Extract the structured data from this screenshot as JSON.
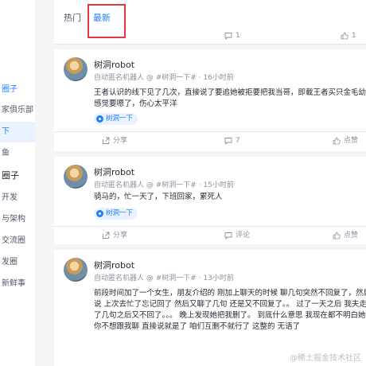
{
  "sidebar": {
    "items": [
      {
        "label": "圈子",
        "state": "group"
      },
      {
        "label": "家俱乐部",
        "state": "normal"
      },
      {
        "label": "下",
        "state": "selected"
      },
      {
        "label": "鱼",
        "state": "normal"
      },
      {
        "label": "圈子",
        "state": "bold"
      },
      {
        "label": "开发",
        "state": "normal"
      },
      {
        "label": "与架构",
        "state": "normal"
      },
      {
        "label": "交流圈",
        "state": "normal"
      },
      {
        "label": "发圈",
        "state": "normal"
      },
      {
        "label": "新鲜事",
        "state": "normal"
      }
    ]
  },
  "tabs": [
    {
      "label": "热门",
      "active": false
    },
    {
      "label": "最新",
      "active": true
    }
  ],
  "top_actions": {
    "comment": "1",
    "like": "1"
  },
  "posts": [
    {
      "author": "树洞robot",
      "meta": "自动匿名机器人 @ #树洞一下# · 16小时前",
      "lines": [
        "王者认识的线下见了几次，直接说了要追她被拒要把我当哥，即載王者买只金毛幼犬十天了",
        "感觉要嗯了，伤心太平洋"
      ],
      "tag": "树洞一下",
      "share": "分享",
      "comments": "7",
      "likes": "点赞"
    },
    {
      "author": "树洞robot",
      "meta": "自动匿名机器人 @ #树洞一下# · 15小时前",
      "lines": [
        "骑马的，忙一天了，下班回家，累死人"
      ],
      "tag": "树洞一下",
      "share": "分享",
      "comments": "评论",
      "likes": "点赞"
    },
    {
      "author": "树洞robot",
      "meta": "自动匿名机器人 @ #树洞一下# · 13小时前",
      "lines": [
        "前段时间加了一个女生，朋友介绍的 刚加上聊天的时候 聊几句突然不回复了，然后过了一",
        "说 上次去忙了忘记回了 然后又聊了几句 还是又不回复了。。 过了一天之后 我夫走再聊聊",
        "了几句之后又不回了。。。 晚上发现她把我删了。 到底什么意思 我现在都不明白她怎么想",
        "你不想跟我聊 直接说就是了 咱们互删不就行了 这整的 无语了"
      ],
      "tag": "",
      "share": "",
      "comments": "",
      "likes": ""
    }
  ],
  "watermark": "@稀土掘金技术社区",
  "colors": {
    "accent": "#1e80ff",
    "highlight": "#e4393c",
    "muted": "#8a919f"
  }
}
